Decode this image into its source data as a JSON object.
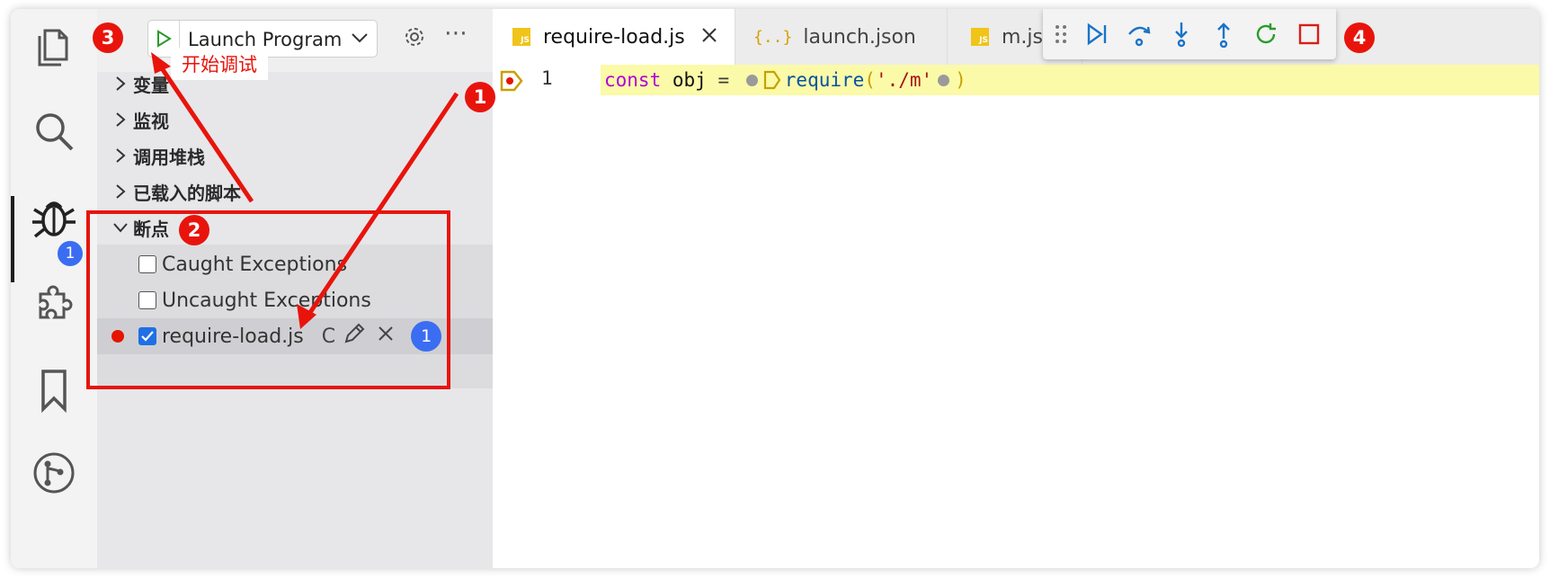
{
  "activity_bar": {
    "debug_badge": "1",
    "icons": [
      "files-icon",
      "search-icon",
      "debug-icon",
      "extensions-icon",
      "bookmark-icon",
      "source-control-icon"
    ]
  },
  "debug": {
    "config_name": "Launch Program",
    "start_label": "开始调试"
  },
  "sidebar": {
    "sections": [
      "变量",
      "监视",
      "调用堆栈",
      "已载入的脚本"
    ],
    "breakpoints": {
      "title": "断点",
      "items": [
        {
          "label": "Caught Exceptions",
          "checked": false
        },
        {
          "label": "Uncaught Exceptions",
          "checked": false
        },
        {
          "label": "require-load.js",
          "checked": true,
          "column_text": "C",
          "count": "1"
        }
      ]
    }
  },
  "tabs": [
    {
      "label": "require-load.js",
      "icon": "js-file-icon",
      "active": true
    },
    {
      "label": "launch.json",
      "icon": "json-file-icon",
      "active": false
    },
    {
      "label": "m.js",
      "icon": "js-file-icon",
      "active": false
    }
  ],
  "json_icon_text": "{..}",
  "js_icon_text": "JS",
  "editor": {
    "line_number": "1",
    "code": {
      "kw": "const",
      "var": "obj",
      "eq": "=",
      "fn": "require",
      "open": "(",
      "str": "'./m'",
      "close": ")"
    }
  },
  "annotations": {
    "a1": "1",
    "a2": "2",
    "a3": "3",
    "a4": "4"
  },
  "colors": {
    "annotation_red": "#e8140c",
    "badge_blue": "#3b6df2",
    "breakpoint_red": "#e51400",
    "highlight_yellow": "#fbfaa8"
  }
}
